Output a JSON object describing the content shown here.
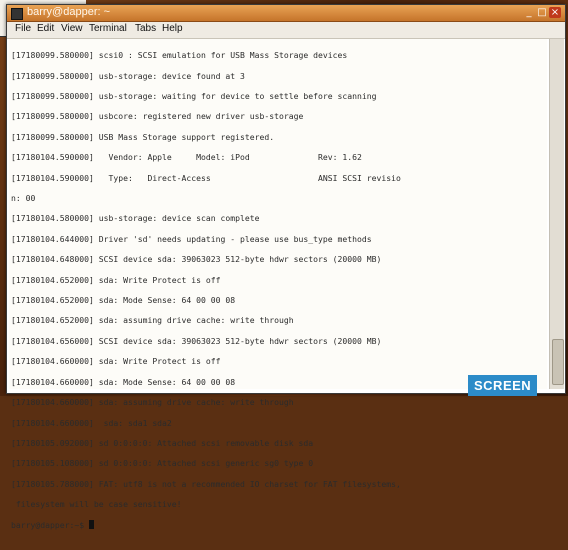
{
  "window": {
    "title": "barry@dapper: ~",
    "minimize": "_",
    "maximize": "□",
    "close": "×"
  },
  "menu": [
    "File",
    "Edit",
    "View",
    "Terminal",
    "Tabs",
    "Help"
  ],
  "terminal": {
    "lines": [
      "[17180099.580000] scsi0 : SCSI emulation for USB Mass Storage devices",
      "[17180099.580000] usb-storage: device found at 3",
      "[17180099.580000] usb-storage: waiting for device to settle before scanning",
      "[17180099.580000] usbcore: registered new driver usb-storage",
      "[17180099.580000] USB Mass Storage support registered.",
      "[17180104.590000]   Vendor: Apple     Model: iPod              Rev: 1.62",
      "[17180104.590000]   Type:   Direct-Access                      ANSI SCSI revisio",
      "n: 00",
      "[17180104.580000] usb-storage: device scan complete",
      "[17180104.644000] Driver 'sd' needs updating - please use bus_type methods",
      "[17180104.648000] SCSI device sda: 39063023 512-byte hdwr sectors (20000 MB)",
      "[17180104.652000] sda: Write Protect is off",
      "[17180104.652000] sda: Mode Sense: 64 00 00 08",
      "[17180104.652000] sda: assuming drive cache: write through",
      "[17180104.656000] SCSI device sda: 39063023 512-byte hdwr sectors (20000 MB)",
      "[17180104.660000] sda: Write Protect is off",
      "[17180104.660000] sda: Mode Sense: 64 00 00 08",
      "[17180104.660000] sda: assuming drive cache: write through",
      "[17180104.660000]  sda: sda1 sda2",
      "[17180105.092000] sd 0:0:0:0: Attached scsi removable disk sda",
      "[17180105.108000] sd 0:0:0:0: Attached scsi generic sg0 type 0",
      "[17180105.788000] FAT: utf8 is not a recommended IO charset for FAT filesystems,",
      " filesystem will be case sensitive!"
    ],
    "prompt": "barry@dapper:~$ "
  },
  "badge": "SCREEN",
  "icons": {
    "window_icon": "terminal-icon",
    "close": "close-icon"
  }
}
